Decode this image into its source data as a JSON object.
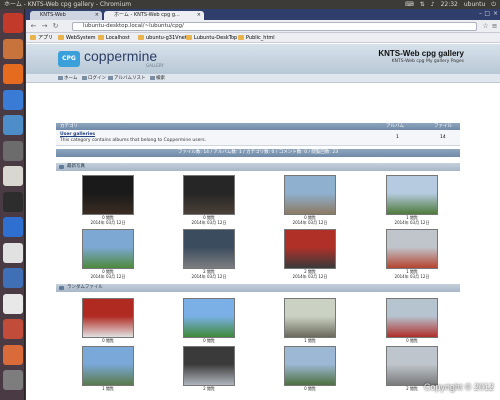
{
  "topbar": {
    "window_title": "ホーム - KNTS-Web cpg gallery - Chromium",
    "time": "22:32",
    "user": "ubuntu"
  },
  "launcher": {
    "items": [
      {
        "name": "dash-icon",
        "color": "#c23b2a"
      },
      {
        "name": "files-icon",
        "color": "#c8733c"
      },
      {
        "name": "firefox-icon",
        "color": "#e66b1f"
      },
      {
        "name": "chromium-icon",
        "color": "#3a7bd5"
      },
      {
        "name": "network-icon",
        "color": "#4e8ec8"
      },
      {
        "name": "settings-icon",
        "color": "#6c6c6c"
      },
      {
        "name": "text-editor-icon",
        "color": "#d8d8d0"
      },
      {
        "name": "terminal-icon",
        "color": "#2d2d2d"
      },
      {
        "name": "document-icon",
        "color": "#2f6fd0"
      },
      {
        "name": "calendar-icon",
        "color": "#e1e1e1"
      },
      {
        "name": "thunderbird-icon",
        "color": "#3f6fb4"
      },
      {
        "name": "text-file-icon",
        "color": "#e8e8e8"
      },
      {
        "name": "tools-icon",
        "color": "#c24c3a"
      },
      {
        "name": "update-icon",
        "color": "#d96a3a"
      },
      {
        "name": "trash-icon",
        "color": "#7d7d7d"
      }
    ]
  },
  "tabs": [
    {
      "label": "KNTS-Web"
    },
    {
      "label": "ホーム - KNTS-Web cpg g..."
    }
  ],
  "address": "lubuntu-desktop.local/~lubuntu/cpg/",
  "bookmarks": [
    "アプリ",
    "WebSystem",
    "Localhost",
    "ubuntu-g31Vnet",
    "Lubuntu-DeskTop",
    "Public_html"
  ],
  "gallery": {
    "logo_badge": "CPG",
    "logo_text": "coppermine",
    "logo_sub": "GALLERY",
    "title": "KNTS-Web cpg gallery",
    "description": "KNTS-Web cpg My gallery Pages"
  },
  "nav": [
    "ホーム",
    "ログイン",
    "アルバムリスト",
    "検索"
  ],
  "category_table": {
    "headers": {
      "category": "カテゴリ",
      "albums": "アルバム",
      "files": "ファイル"
    },
    "row": {
      "name": "User galleries",
      "desc": "This category contains albums that belong to Coppermine users.",
      "albums": "1",
      "files": "14"
    }
  },
  "stats": "ファイル数: 14 / アルバム数: 1 / カテゴリ数: 0 / コメント数: 0 / 閲覧回数: 23",
  "latest": {
    "heading": "最新写真",
    "items": [
      {
        "views": "0 閲覧",
        "date": "2014年 03月 12日",
        "c1": "#1a1a1a",
        "c2": "#3a2c22"
      },
      {
        "views": "0 閲覧",
        "date": "2014年 03月 12日",
        "c1": "#262626",
        "c2": "#4a4038"
      },
      {
        "views": "0 閲覧",
        "date": "2014年 03月 12日",
        "c1": "#8fb0cf",
        "c2": "#8c7a63"
      },
      {
        "views": "1 閲覧",
        "date": "2014年 03月 12日",
        "c1": "#b6cbe0",
        "c2": "#4f7a3a"
      },
      {
        "views": "0 閲覧",
        "date": "2014年 03月 12日",
        "c1": "#7da8d4",
        "c2": "#4d8a3c"
      },
      {
        "views": "2 閲覧",
        "date": "2014年 03月 12日",
        "c1": "#3b4c5e",
        "c2": "#7d7d80"
      },
      {
        "views": "2 閲覧",
        "date": "2014年 03月 12日",
        "c1": "#b03028",
        "c2": "#3a3a3a"
      },
      {
        "views": "1 閲覧",
        "date": "2014年 03月 12日",
        "c1": "#c0c5cc",
        "c2": "#b5442f"
      }
    ]
  },
  "random": {
    "heading": "ランダムファイル",
    "items": [
      {
        "views": "0 閲覧",
        "c1": "#b02a22",
        "c2": "#e1e1e1"
      },
      {
        "views": "0 閲覧",
        "c1": "#7ab0e6",
        "c2": "#3e8a3a"
      },
      {
        "views": "1 閲覧",
        "c1": "#cbd2c4",
        "c2": "#6a6a5a"
      },
      {
        "views": "0 閲覧",
        "c1": "#b6c4d0",
        "c2": "#b02e2a"
      },
      {
        "views": "1 閲覧",
        "c1": "#7aa8d8",
        "c2": "#5a7a4a"
      },
      {
        "views": "2 閲覧",
        "c1": "#3a3a3a",
        "c2": "#b0b5bd"
      },
      {
        "views": "0 閲覧",
        "c1": "#9cb8d4",
        "c2": "#4e7040"
      },
      {
        "views": "2 閲覧",
        "c1": "#bfc5cc",
        "c2": "#7a7a7a"
      }
    ]
  },
  "watermark": "Copyright © 2012"
}
